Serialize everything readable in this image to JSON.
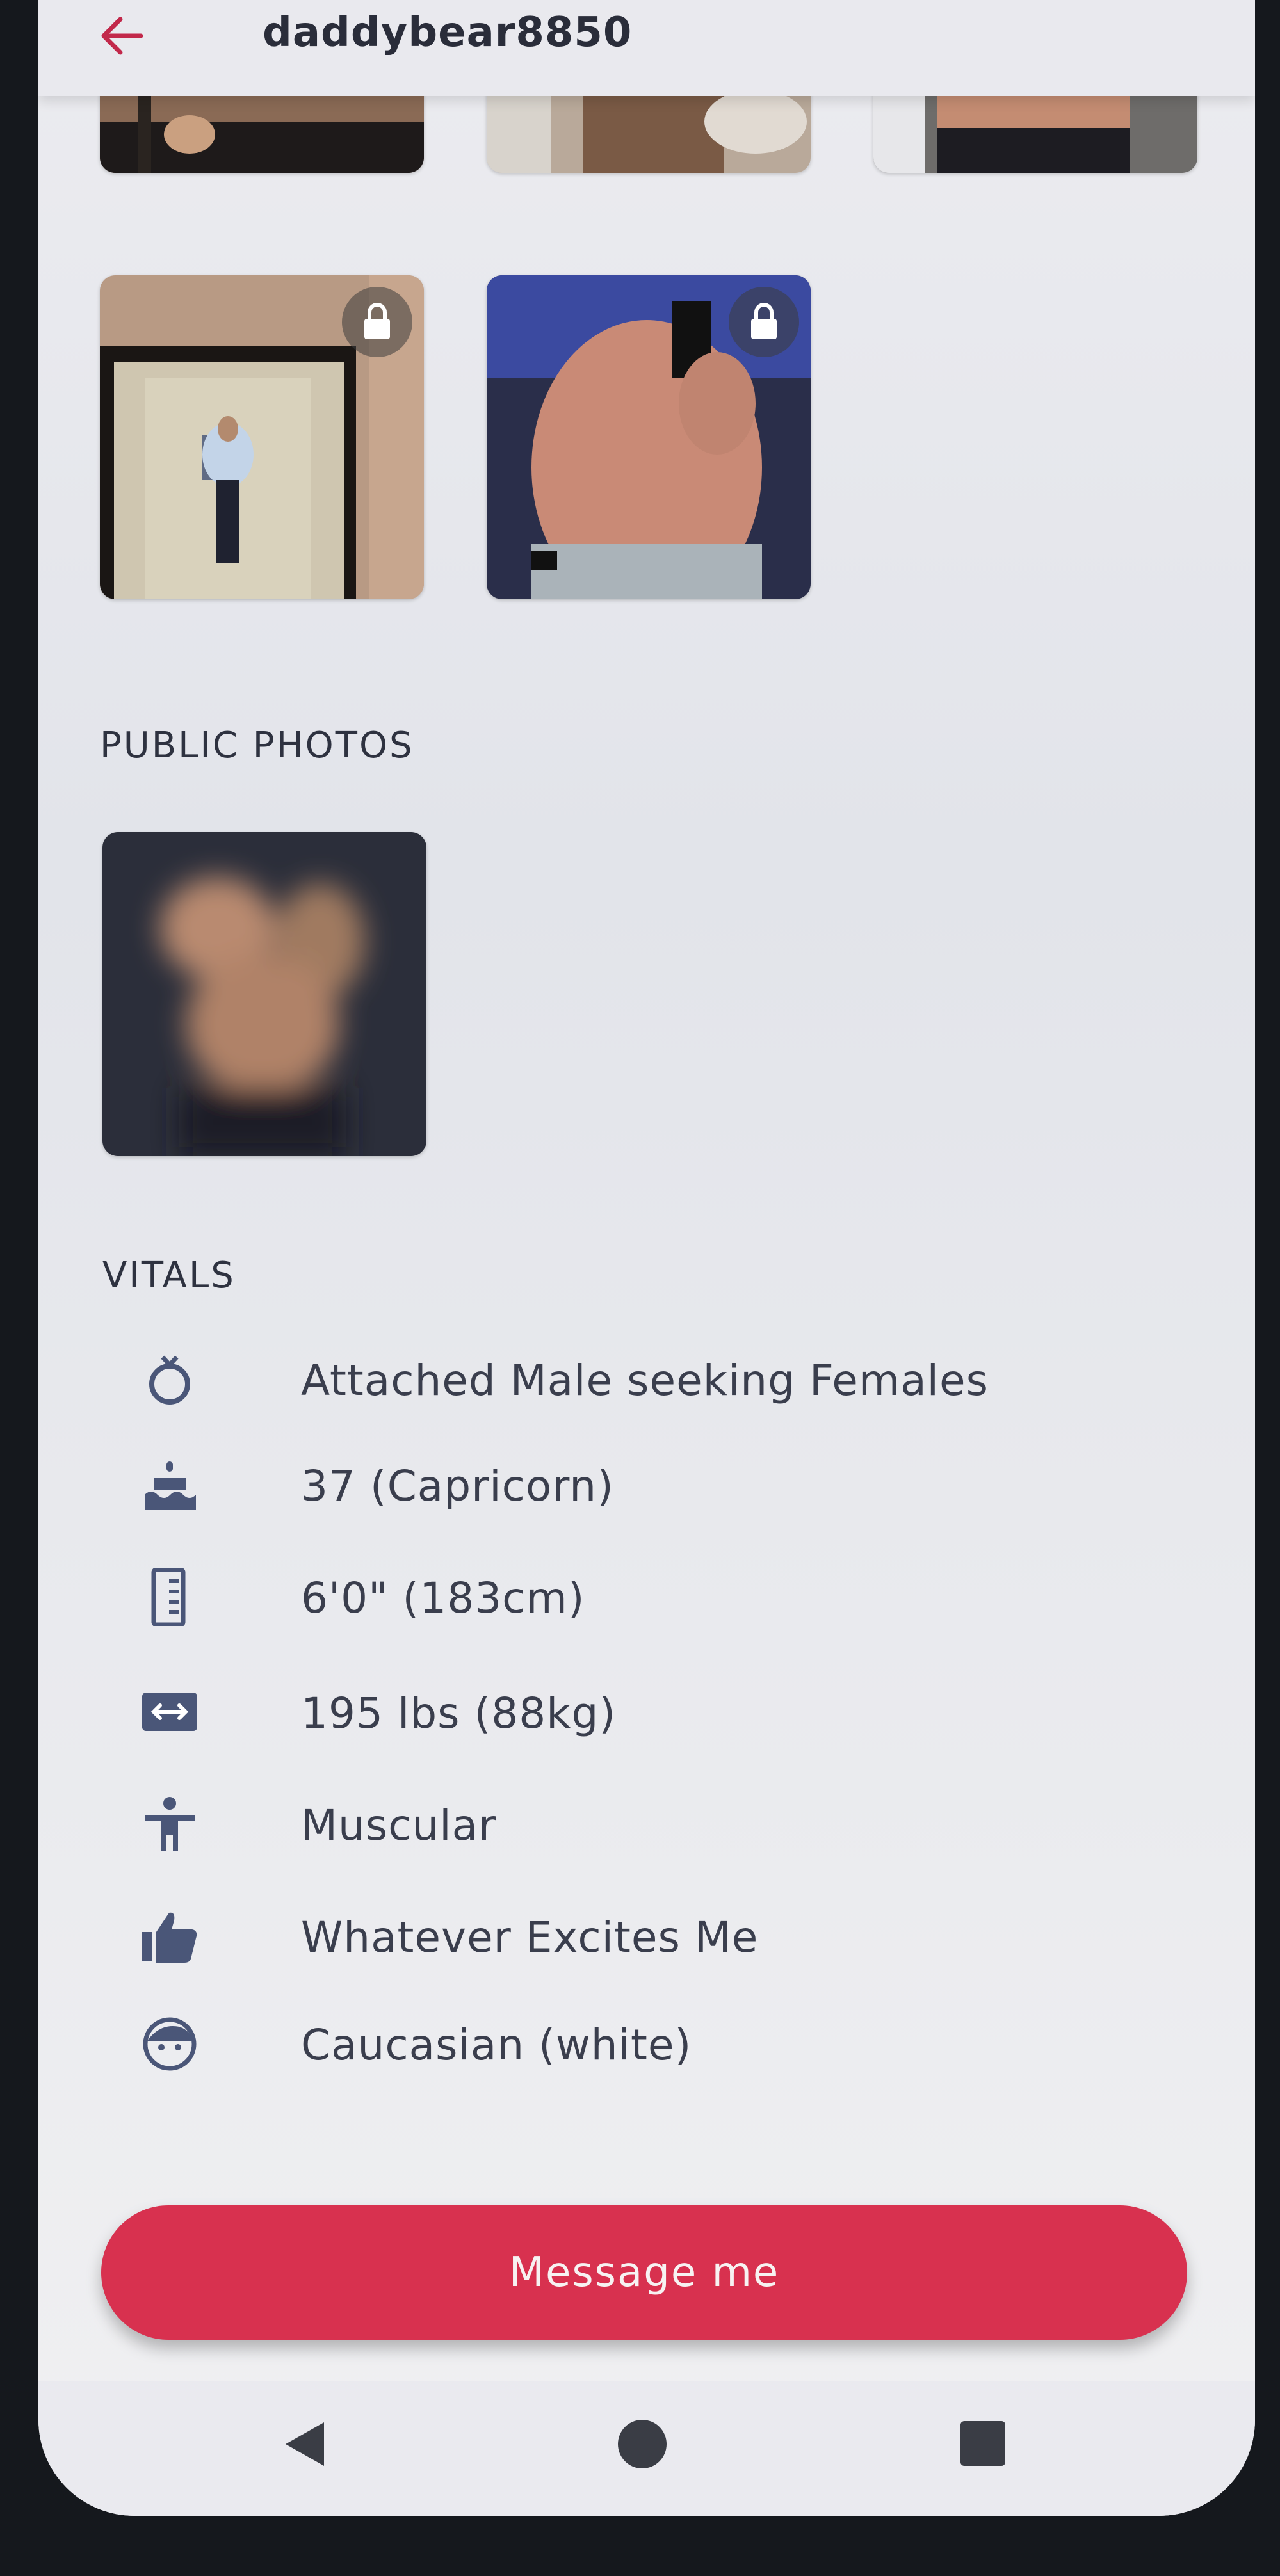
{
  "header": {
    "username": "daddybear8850"
  },
  "sections": {
    "public_photos_title": "PUBLIC PHOTOS",
    "vitals_title": "VITALS"
  },
  "vitals": [
    {
      "icon": "gender-ring-icon",
      "text": "Attached Male seeking Females"
    },
    {
      "icon": "birthday-cake-icon",
      "text": "37 (Capricorn)"
    },
    {
      "icon": "ruler-icon",
      "text": "6'0\" (183cm)"
    },
    {
      "icon": "weight-arrows-icon",
      "text": "195 lbs (88kg)"
    },
    {
      "icon": "body-type-icon",
      "text": "Muscular"
    },
    {
      "icon": "thumbs-up-icon",
      "text": "Whatever Excites Me"
    },
    {
      "icon": "face-icon",
      "text": "Caucasian (white)"
    }
  ],
  "actions": {
    "message_label": "Message me"
  },
  "colors": {
    "accent": "#d8314f",
    "back_arrow": "#c2284a",
    "icon": "#4a5678"
  }
}
